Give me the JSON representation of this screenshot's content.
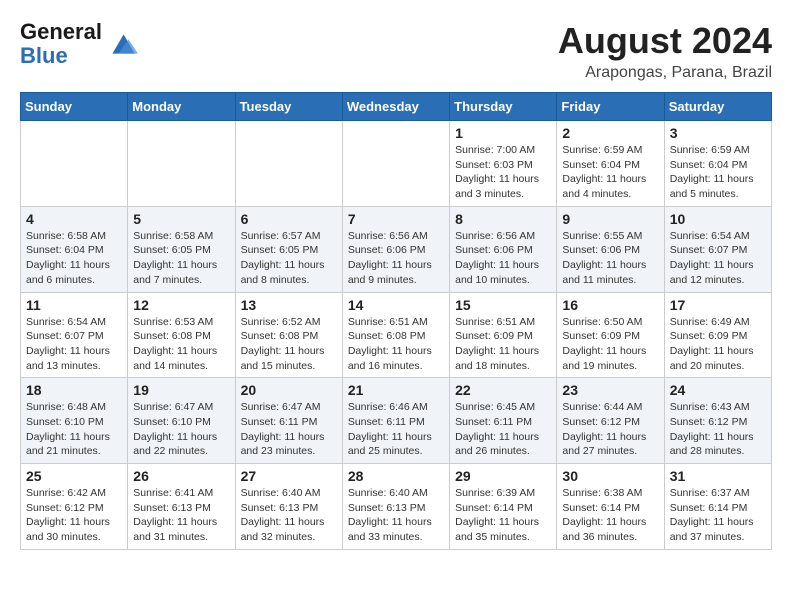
{
  "header": {
    "logo_general": "General",
    "logo_blue": "Blue",
    "month_year": "August 2024",
    "location": "Arapongas, Parana, Brazil"
  },
  "days_of_week": [
    "Sunday",
    "Monday",
    "Tuesday",
    "Wednesday",
    "Thursday",
    "Friday",
    "Saturday"
  ],
  "weeks": [
    [
      {
        "day": "",
        "info": ""
      },
      {
        "day": "",
        "info": ""
      },
      {
        "day": "",
        "info": ""
      },
      {
        "day": "",
        "info": ""
      },
      {
        "day": "1",
        "info": "Sunrise: 7:00 AM\nSunset: 6:03 PM\nDaylight: 11 hours\nand 3 minutes."
      },
      {
        "day": "2",
        "info": "Sunrise: 6:59 AM\nSunset: 6:04 PM\nDaylight: 11 hours\nand 4 minutes."
      },
      {
        "day": "3",
        "info": "Sunrise: 6:59 AM\nSunset: 6:04 PM\nDaylight: 11 hours\nand 5 minutes."
      }
    ],
    [
      {
        "day": "4",
        "info": "Sunrise: 6:58 AM\nSunset: 6:04 PM\nDaylight: 11 hours\nand 6 minutes."
      },
      {
        "day": "5",
        "info": "Sunrise: 6:58 AM\nSunset: 6:05 PM\nDaylight: 11 hours\nand 7 minutes."
      },
      {
        "day": "6",
        "info": "Sunrise: 6:57 AM\nSunset: 6:05 PM\nDaylight: 11 hours\nand 8 minutes."
      },
      {
        "day": "7",
        "info": "Sunrise: 6:56 AM\nSunset: 6:06 PM\nDaylight: 11 hours\nand 9 minutes."
      },
      {
        "day": "8",
        "info": "Sunrise: 6:56 AM\nSunset: 6:06 PM\nDaylight: 11 hours\nand 10 minutes."
      },
      {
        "day": "9",
        "info": "Sunrise: 6:55 AM\nSunset: 6:06 PM\nDaylight: 11 hours\nand 11 minutes."
      },
      {
        "day": "10",
        "info": "Sunrise: 6:54 AM\nSunset: 6:07 PM\nDaylight: 11 hours\nand 12 minutes."
      }
    ],
    [
      {
        "day": "11",
        "info": "Sunrise: 6:54 AM\nSunset: 6:07 PM\nDaylight: 11 hours\nand 13 minutes."
      },
      {
        "day": "12",
        "info": "Sunrise: 6:53 AM\nSunset: 6:08 PM\nDaylight: 11 hours\nand 14 minutes."
      },
      {
        "day": "13",
        "info": "Sunrise: 6:52 AM\nSunset: 6:08 PM\nDaylight: 11 hours\nand 15 minutes."
      },
      {
        "day": "14",
        "info": "Sunrise: 6:51 AM\nSunset: 6:08 PM\nDaylight: 11 hours\nand 16 minutes."
      },
      {
        "day": "15",
        "info": "Sunrise: 6:51 AM\nSunset: 6:09 PM\nDaylight: 11 hours\nand 18 minutes."
      },
      {
        "day": "16",
        "info": "Sunrise: 6:50 AM\nSunset: 6:09 PM\nDaylight: 11 hours\nand 19 minutes."
      },
      {
        "day": "17",
        "info": "Sunrise: 6:49 AM\nSunset: 6:09 PM\nDaylight: 11 hours\nand 20 minutes."
      }
    ],
    [
      {
        "day": "18",
        "info": "Sunrise: 6:48 AM\nSunset: 6:10 PM\nDaylight: 11 hours\nand 21 minutes."
      },
      {
        "day": "19",
        "info": "Sunrise: 6:47 AM\nSunset: 6:10 PM\nDaylight: 11 hours\nand 22 minutes."
      },
      {
        "day": "20",
        "info": "Sunrise: 6:47 AM\nSunset: 6:11 PM\nDaylight: 11 hours\nand 23 minutes."
      },
      {
        "day": "21",
        "info": "Sunrise: 6:46 AM\nSunset: 6:11 PM\nDaylight: 11 hours\nand 25 minutes."
      },
      {
        "day": "22",
        "info": "Sunrise: 6:45 AM\nSunset: 6:11 PM\nDaylight: 11 hours\nand 26 minutes."
      },
      {
        "day": "23",
        "info": "Sunrise: 6:44 AM\nSunset: 6:12 PM\nDaylight: 11 hours\nand 27 minutes."
      },
      {
        "day": "24",
        "info": "Sunrise: 6:43 AM\nSunset: 6:12 PM\nDaylight: 11 hours\nand 28 minutes."
      }
    ],
    [
      {
        "day": "25",
        "info": "Sunrise: 6:42 AM\nSunset: 6:12 PM\nDaylight: 11 hours\nand 30 minutes."
      },
      {
        "day": "26",
        "info": "Sunrise: 6:41 AM\nSunset: 6:13 PM\nDaylight: 11 hours\nand 31 minutes."
      },
      {
        "day": "27",
        "info": "Sunrise: 6:40 AM\nSunset: 6:13 PM\nDaylight: 11 hours\nand 32 minutes."
      },
      {
        "day": "28",
        "info": "Sunrise: 6:40 AM\nSunset: 6:13 PM\nDaylight: 11 hours\nand 33 minutes."
      },
      {
        "day": "29",
        "info": "Sunrise: 6:39 AM\nSunset: 6:14 PM\nDaylight: 11 hours\nand 35 minutes."
      },
      {
        "day": "30",
        "info": "Sunrise: 6:38 AM\nSunset: 6:14 PM\nDaylight: 11 hours\nand 36 minutes."
      },
      {
        "day": "31",
        "info": "Sunrise: 6:37 AM\nSunset: 6:14 PM\nDaylight: 11 hours\nand 37 minutes."
      }
    ]
  ]
}
